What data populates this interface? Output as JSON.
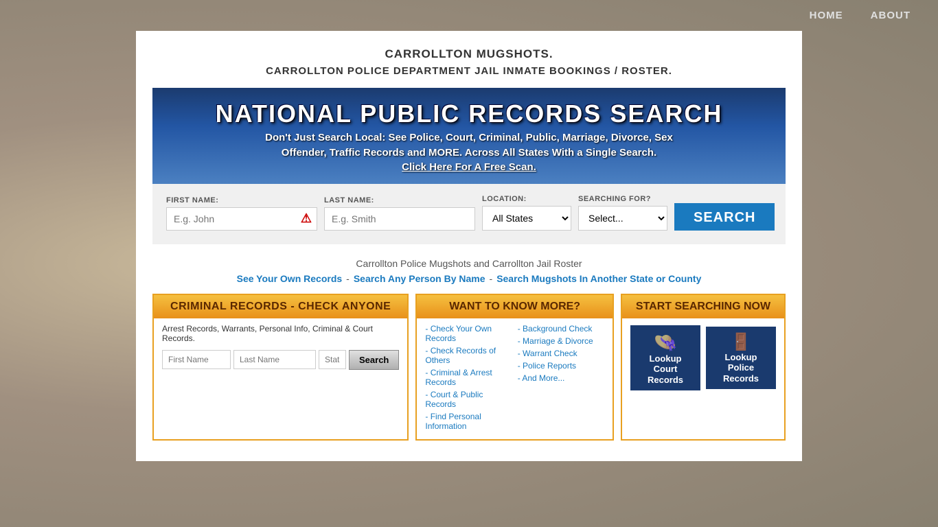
{
  "nav": {
    "home_label": "HOME",
    "about_label": "ABOUT"
  },
  "page": {
    "title": "CARROLLTON MUGSHOTS.",
    "subtitle": "CARROLLTON POLICE DEPARTMENT JAIL INMATE BOOKINGS / ROSTER."
  },
  "banner": {
    "title": "NATIONAL PUBLIC RECORDS SEARCH",
    "subtitle": "Don't Just Search Local: See Police, Court, Criminal, Public, Marriage, Divorce, Sex\nOffender, Traffic Records and MORE. Across All States With a Single Search.",
    "link_text": "Click Here For A Free Scan."
  },
  "search_form": {
    "first_name_label": "FIRST NAME:",
    "first_name_placeholder": "E.g. John",
    "last_name_label": "LAST NAME:",
    "last_name_placeholder": "E.g. Smith",
    "location_label": "LOCATION:",
    "location_default": "All States",
    "searching_label": "SEARCHING FOR?",
    "searching_default": "Select...",
    "search_button": "SEARCH"
  },
  "middle": {
    "description": "Carrollton Police Mugshots and Carrollton Jail Roster",
    "link1": "See Your Own Records",
    "separator1": "-",
    "link2": "Search Any Person By Name",
    "separator2": "-",
    "link3": "Search Mugshots In Another State or County"
  },
  "widget_criminal": {
    "header": "CRIMINAL RECORDS - CHECK ANYONE",
    "description": "Arrest Records, Warrants, Personal Info, Criminal & Court Records.",
    "firstname_placeholder": "First Name",
    "lastname_placeholder": "Last Name",
    "state_placeholder": "State",
    "search_button": "Search"
  },
  "widget_know": {
    "header": "WANT TO KNOW MORE?",
    "links_col1": [
      "- Check Your Own Records",
      "- Check Records of Others",
      "- Criminal & Arrest Records",
      "- Court & Public Records",
      "- Find Personal Information"
    ],
    "links_col2": [
      "- Background Check",
      "- Marriage & Divorce",
      "- Warrant Check",
      "- Police Reports",
      "- And More..."
    ]
  },
  "widget_start": {
    "header": "START SEARCHING NOW",
    "btn1_line1": "Lookup",
    "btn1_line2": "Court",
    "btn1_line3": "Records",
    "btn2_line1": "Lookup",
    "btn2_line2": "Police",
    "btn2_line3": "Records"
  }
}
